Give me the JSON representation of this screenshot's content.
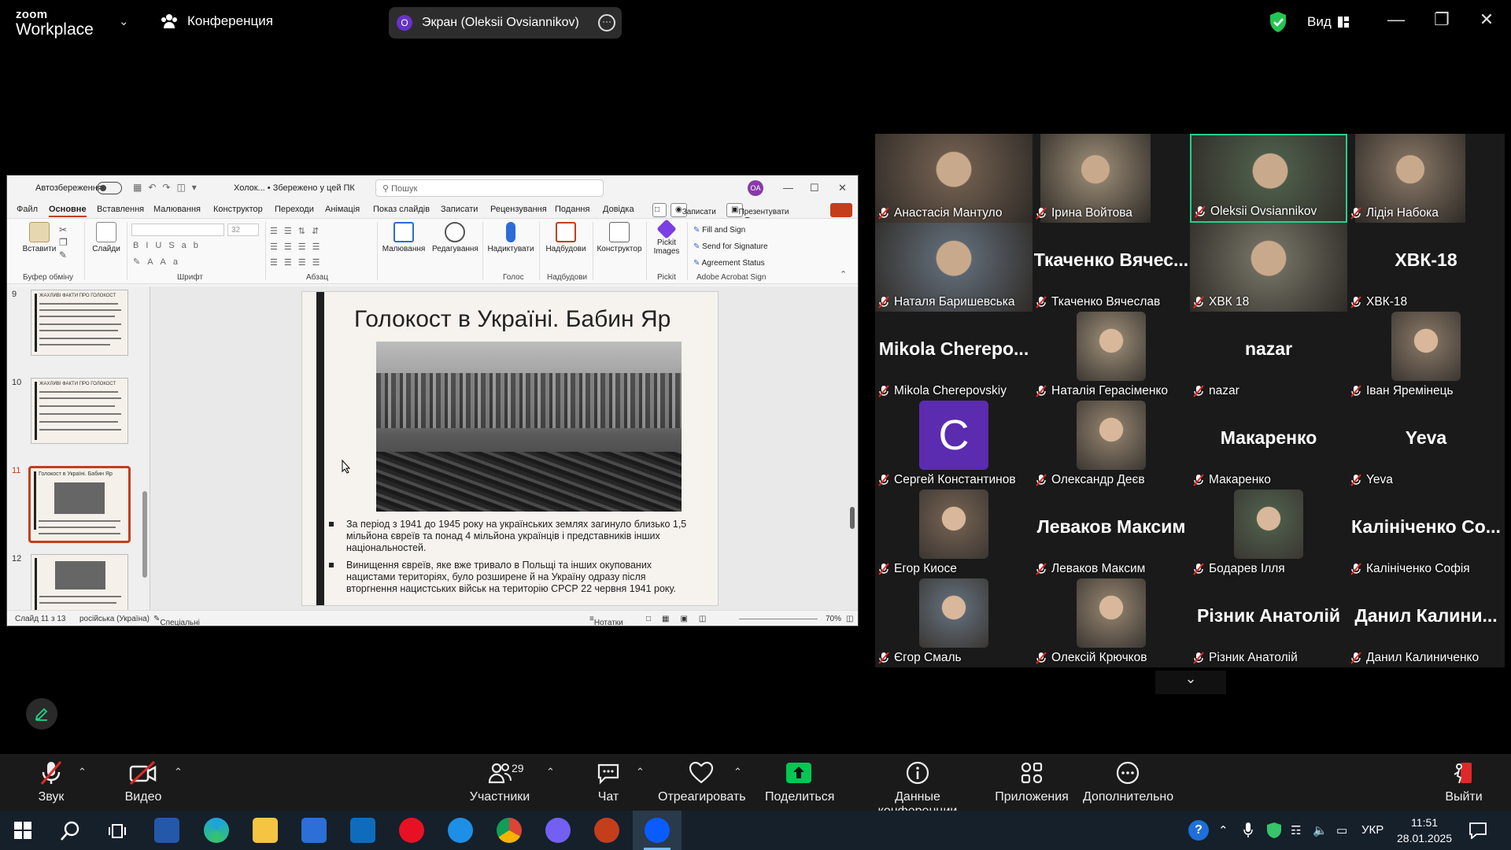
{
  "app": {
    "logo_line1": "zoom",
    "logo_line2": "Workplace",
    "meeting_label": "Конференция",
    "share_avatar": "O",
    "share_label": "Экран (Oleksii Ovsiannikov)",
    "view_label": "Вид"
  },
  "powerpoint": {
    "autosave": "Автозбереження",
    "filename": "Холок... • Збережено у цей ПК",
    "search_placeholder": "Пошук",
    "user_initials": "OA",
    "tabs": [
      "Файл",
      "Основне",
      "Вставлення",
      "Малювання",
      "Конструктор",
      "Переходи",
      "Анімація",
      "Показ слайдів",
      "Записати",
      "Рецензування",
      "Подання",
      "Довідка"
    ],
    "active_tab": "Основне",
    "record_btn": "Записати",
    "teams_btn": "Презентувати в Teams",
    "ribbon": {
      "paste": "Вставити",
      "slides": "Слайди",
      "draw": "Малювання",
      "edit": "Редагування",
      "dictate": "Надиктувати",
      "addins": "Надбудови",
      "designer": "Конструктор",
      "pickit": "Pickit Images",
      "fill_sign": "Fill and Sign",
      "send_sig": "Send for Signature",
      "agreement": "Agreement Status",
      "group_clipboard": "Буфер обміну",
      "group_font": "Шрифт",
      "group_para": "Абзац",
      "group_voice": "Голос",
      "group_addins": "Надбудови",
      "group_pickit": "Pickit",
      "group_adobe": "Adobe Acrobat Sign",
      "font_size": "32"
    },
    "thumbs": [
      {
        "num": "9",
        "title": "ЖАХЛИВІ ФАКТИ ПРО ГОЛОКОСТ"
      },
      {
        "num": "10",
        "title": "ЖАХЛИВІ ФАКТИ ПРО ГОЛОКОСТ"
      },
      {
        "num": "11",
        "title": "Голокост в Україні. Бабин Яр"
      },
      {
        "num": "12",
        "title": ""
      }
    ],
    "slide": {
      "title": "Голокост в Україні. Бабин Яр",
      "bullet1": "За період з 1941 до 1945 року на українських землях загинуло близько 1,5 мільйона євреїв та понад 4 мільйона українців і представників інших національностей.",
      "bullet2": "Винищення євреїв, яке вже тривало в Польщі та інших окупованих нацистами територіях, було розширене й на Україну одразу після вторгнення нацистських військ на територію СРСР 22 червня 1941 року."
    },
    "status": {
      "slide_of": "Слайд 11 з 13",
      "language": "російська (Україна)",
      "accessibility": "Спеціальні можливості: щось не так",
      "notes": "Нотатки",
      "zoom": "70%"
    }
  },
  "participants": [
    {
      "name": "Анастасія Мантуло",
      "big": "",
      "kind": "video",
      "col": 0,
      "row": 0
    },
    {
      "name": "Ірина Войтова",
      "big": "",
      "kind": "video",
      "col": 1,
      "row": 0
    },
    {
      "name": "Oleksii Ovsiannikov",
      "big": "",
      "kind": "video",
      "col": 2,
      "row": 0
    },
    {
      "name": "Лідія Набока",
      "big": "",
      "kind": "video",
      "col": 3,
      "row": 0
    },
    {
      "name": "Наталя Баришевська",
      "big": "",
      "kind": "video",
      "col": 0,
      "row": 1
    },
    {
      "name": "Ткаченко Вячеслав",
      "big": "Ткаченко Вячес...",
      "kind": "name",
      "col": 1,
      "row": 1
    },
    {
      "name": "ХВК 18",
      "big": "",
      "kind": "video",
      "col": 2,
      "row": 1
    },
    {
      "name": "ХВК-18",
      "big": "ХВК-18",
      "kind": "name",
      "col": 3,
      "row": 1
    },
    {
      "name": "Mikola Cherepovskiy",
      "big": "Mikola Cherepo...",
      "kind": "name",
      "col": 0,
      "row": 2
    },
    {
      "name": "Наталія Герасіменко",
      "big": "",
      "kind": "photo",
      "col": 1,
      "row": 2
    },
    {
      "name": "nazar",
      "big": "nazar",
      "kind": "name",
      "col": 2,
      "row": 2
    },
    {
      "name": "Іван Яремінець",
      "big": "",
      "kind": "photo",
      "col": 3,
      "row": 2
    },
    {
      "name": "Сергей Константинов",
      "big": "C",
      "kind": "letter",
      "col": 0,
      "row": 3
    },
    {
      "name": "Олександр Деєв",
      "big": "",
      "kind": "photo",
      "col": 1,
      "row": 3
    },
    {
      "name": "Макаренко",
      "big": "Макаренко",
      "kind": "name",
      "col": 2,
      "row": 3
    },
    {
      "name": "Yeva",
      "big": "Yeva",
      "kind": "name",
      "col": 3,
      "row": 3
    },
    {
      "name": "Егор Киосе",
      "big": "",
      "kind": "photo",
      "col": 0,
      "row": 4
    },
    {
      "name": "Леваков Максим",
      "big": "Леваков Максим",
      "kind": "name",
      "col": 1,
      "row": 4
    },
    {
      "name": "Бодарев Ілля",
      "big": "",
      "kind": "photo",
      "col": 2,
      "row": 4
    },
    {
      "name": "Калініченко Софія",
      "big": "Калініченко Со...",
      "kind": "name",
      "col": 3,
      "row": 4
    },
    {
      "name": "Єгор Смаль",
      "big": "",
      "kind": "photo",
      "col": 0,
      "row": 5
    },
    {
      "name": "Олексій Крючков",
      "big": "",
      "kind": "photo",
      "col": 1,
      "row": 5
    },
    {
      "name": "Різник Анатолій",
      "big": "Різник Анатолій",
      "kind": "name",
      "col": 2,
      "row": 5
    },
    {
      "name": "Данил Калиниченко",
      "big": "Данил Калини...",
      "kind": "name",
      "col": 3,
      "row": 5
    }
  ],
  "toolbar": {
    "audio": "Звук",
    "video": "Видео",
    "participants": "Участники",
    "participants_count": "29",
    "chat": "Чат",
    "react": "Отреагировать",
    "share": "Поделиться",
    "info": "Данные конференции",
    "apps": "Приложения",
    "more": "Дополнительно",
    "leave": "Выйти"
  },
  "taskbar": {
    "lang": "УКР",
    "time": "11:51",
    "date": "28.01.2025"
  },
  "colors": {
    "active_speaker": "#23d18b",
    "ppt_accent": "#c43e1c",
    "muted_red": "#e02828",
    "share_green": "#00c853"
  }
}
